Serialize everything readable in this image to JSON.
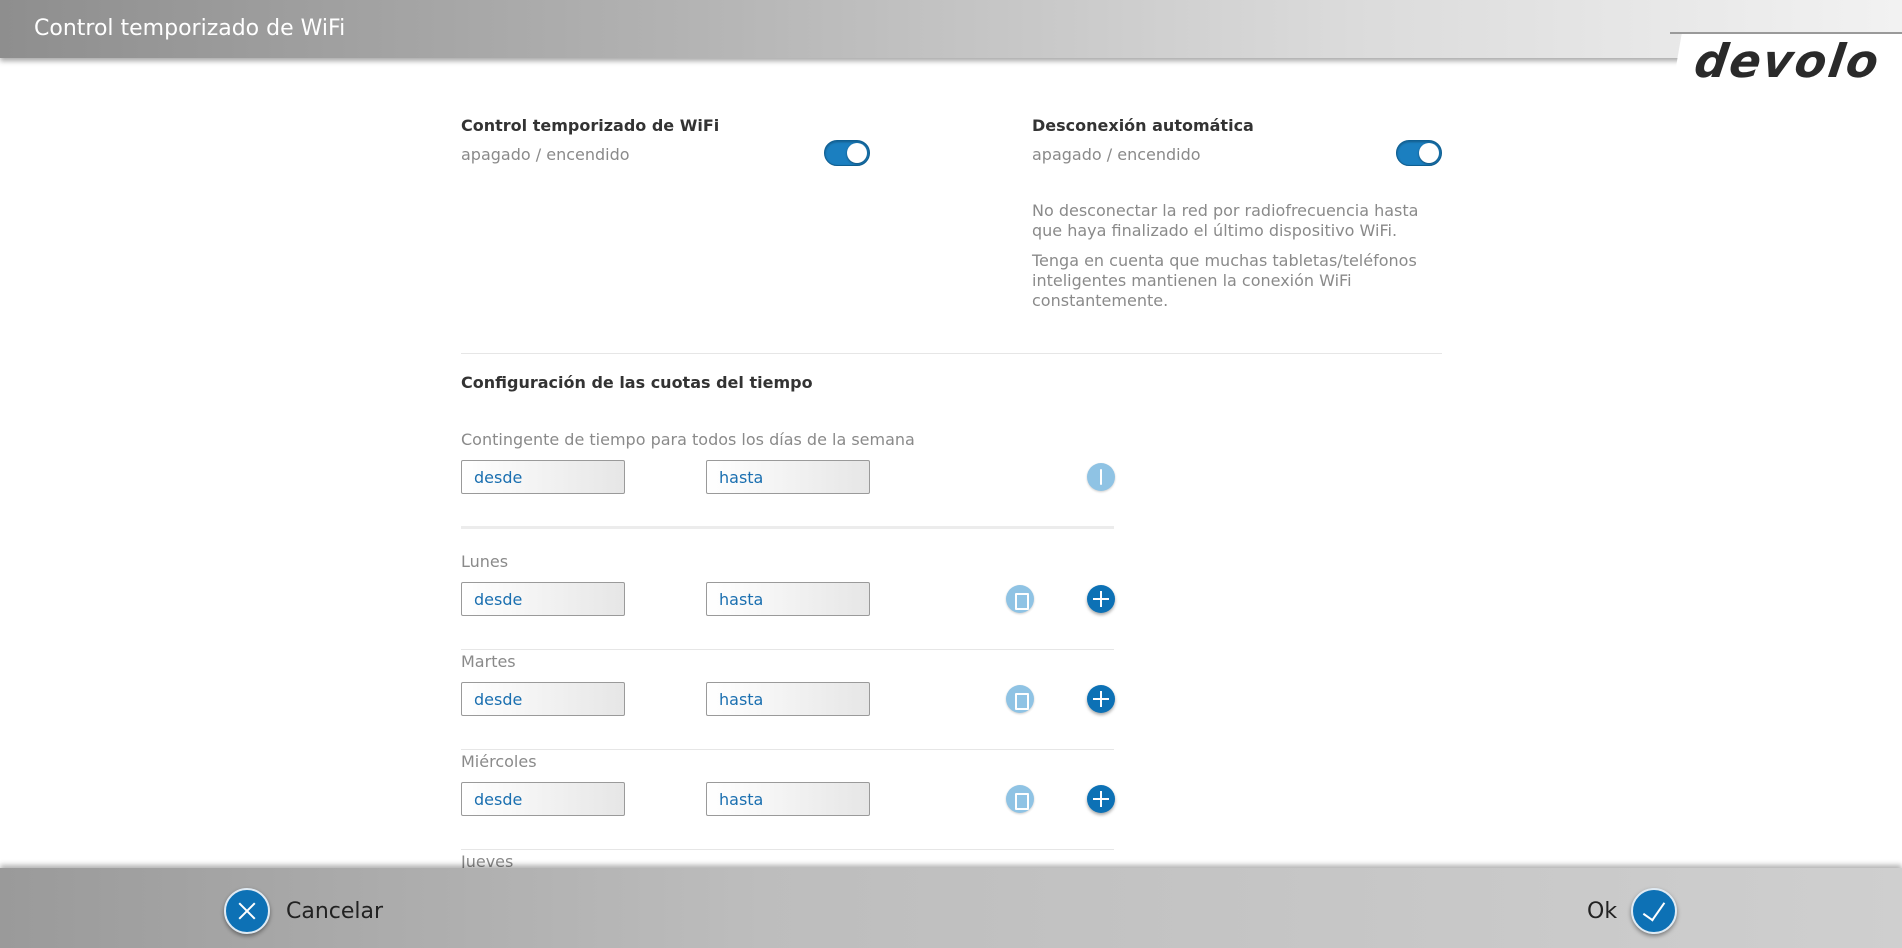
{
  "header": {
    "title": "Control temporizado de WiFi",
    "logo": "devolo"
  },
  "wifi_timer": {
    "title": "Control temporizado de WiFi",
    "toggle_label": "apagado / encendido",
    "enabled": true
  },
  "auto_disconnect": {
    "title": "Desconexión automática",
    "toggle_label": "apagado / encendido",
    "enabled": true,
    "desc1": "No desconectar la red por radiofrecuencia hasta que haya finalizado el último dispositivo WiFi.",
    "desc2": "Tenga en cuenta que muchas tabletas/teléfonos inteligentes mantienen la conexión WiFi constantemente."
  },
  "quota": {
    "title": "Configuración de las cuotas del tiempo",
    "all_days_label": "Contingente de tiempo para todos los días de la semana",
    "from_placeholder": "desde",
    "to_placeholder": "hasta"
  },
  "days": [
    {
      "name": "Lunes"
    },
    {
      "name": "Martes"
    },
    {
      "name": "Miércoles"
    },
    {
      "name": "Jueves"
    }
  ],
  "icons": {
    "info": "info-icon",
    "delete": "trash-icon",
    "add": "plus-icon",
    "cancel": "x-icon",
    "ok": "check-icon"
  },
  "colors": {
    "accent": "#0d71b5",
    "accent_light": "#8fc3e4",
    "text_blue": "#1a6fb0"
  },
  "footer": {
    "cancel_label": "Cancelar",
    "ok_label": "Ok"
  }
}
